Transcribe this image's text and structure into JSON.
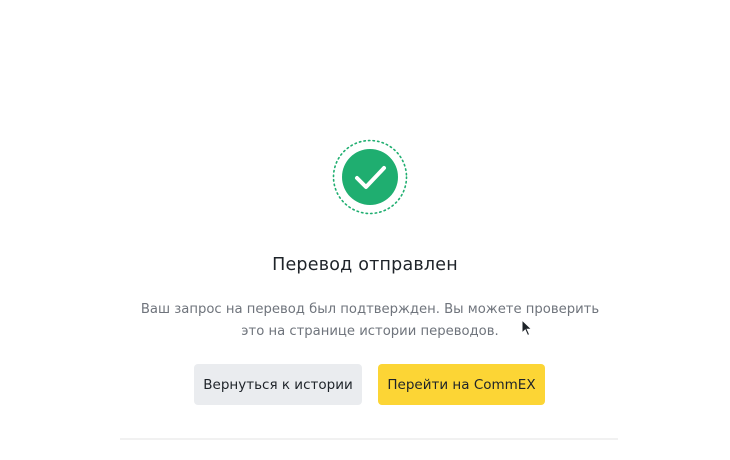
{
  "colors": {
    "success": "#1fae70",
    "primary_button": "#fcd535",
    "secondary_button": "#eaecef"
  },
  "icon": "check-circle-icon",
  "dialog": {
    "title": "Перевод отправлен",
    "description_line1": "Ваш запрос на перевод был подтвержден. Вы можете проверить",
    "description_line2": "это на странице истории переводов."
  },
  "buttons": {
    "back_label": "Вернуться к истории",
    "go_label": "Перейти на CommEX"
  }
}
